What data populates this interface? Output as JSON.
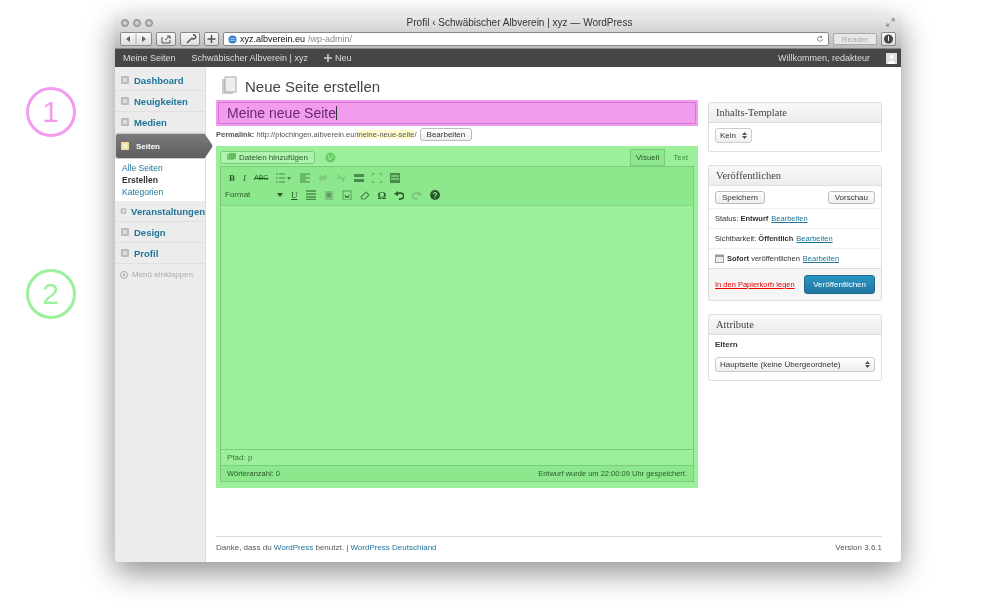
{
  "annotations": [
    {
      "label": "1",
      "color": "#f29cf0"
    },
    {
      "label": "2",
      "color": "#9cf09c"
    }
  ],
  "browser": {
    "title": "Profil ‹ Schwäbischer Albverein | xyz — WordPress",
    "url_host": "xyz.albverein.eu",
    "url_path": "/wp-admin/",
    "reader": "Reader"
  },
  "admin_bar": {
    "items": [
      "Meine Seiten",
      "Schwäbischer Albverein | xyz"
    ],
    "new": "Neu",
    "greeting": "Willkommen, redakteur"
  },
  "sidebar": {
    "items": [
      {
        "label": "Dashboard",
        "selected": false
      },
      {
        "label": "Neuigkeiten",
        "selected": false
      },
      {
        "label": "Medien",
        "selected": false
      },
      {
        "label": "Seiten",
        "selected": true,
        "children": [
          {
            "label": "Alle Seiten",
            "selected": false
          },
          {
            "label": "Erstellen",
            "selected": true
          },
          {
            "label": "Kategorien",
            "selected": false
          }
        ]
      },
      {
        "label": "Veranstaltungen",
        "selected": false
      },
      {
        "label": "Design",
        "selected": false
      },
      {
        "label": "Profil",
        "selected": false
      }
    ],
    "collapse": "Menü einklappen"
  },
  "page": {
    "heading": "Neue Seite erstellen",
    "title_value": "Meine neue Seite",
    "permalink": {
      "label": "Permalink:",
      "base": "http://plochingen.albverein.eu/",
      "slug": "meine-neue-seite",
      "end": "/",
      "button": "Bearbeiten"
    }
  },
  "editor": {
    "add_media": "Dateien hinzufügen",
    "tabs": [
      {
        "label": "Visuell",
        "selected": true
      },
      {
        "label": "Text",
        "selected": false
      }
    ],
    "glyphs": {
      "bold": "B",
      "italic": "I",
      "strike": "ABC",
      "underline": "U",
      "omega": "Ω"
    },
    "format": "Format",
    "path": "Pfad: p",
    "word_count": "Wörteranzahl: 0",
    "autosave": "Entwurf wurde um 22:00:09 Uhr gespeichert."
  },
  "template_box": {
    "title": "Inhalts-Template",
    "select": "Kein"
  },
  "publish_box": {
    "title": "Veröffentlichen",
    "save": "Speichern",
    "preview": "Vorschau",
    "rows": [
      {
        "label": "Status:",
        "value": "Entwurf",
        "link": "Bearbeiten",
        "kind": "plain"
      },
      {
        "label": "Sichtbarkeit:",
        "value": "Öffentlich",
        "link": "Bearbeiten",
        "kind": "plain"
      },
      {
        "label": "veröffentlichen",
        "value": "Sofort",
        "link": "Bearbeiten",
        "kind": "calendar"
      }
    ],
    "trash": "In den Papierkorb legen",
    "publish": "Veröffentlichen"
  },
  "attributes_box": {
    "title": "Attribute",
    "label": "Eltern",
    "select": "Hauptseite (keine Übergeordnete)"
  },
  "footer": {
    "before": "Danke, dass du",
    "link": "WordPress",
    "middle": "benutzt. |",
    "link2": "WordPress Deutschland",
    "version": "Version 3.6.1"
  }
}
